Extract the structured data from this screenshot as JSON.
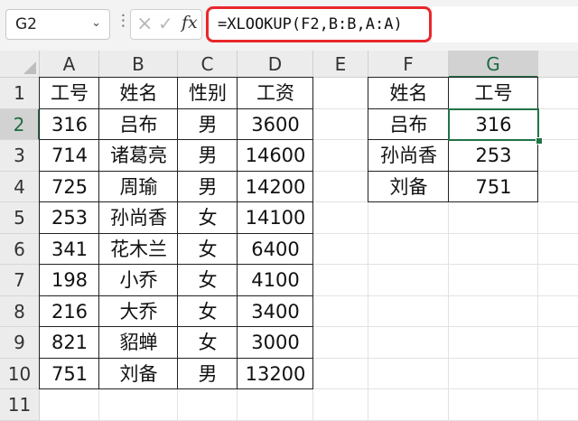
{
  "name_box": {
    "value": "G2"
  },
  "formula_bar": {
    "formula": "=XLOOKUP(F2,B:B,A:A)",
    "fx_label": "fx"
  },
  "icons": {
    "more": "vertical-dots-icon",
    "cancel": "x-icon",
    "enter": "check-icon",
    "function": "fx-icon"
  },
  "colors": {
    "highlight_border": "#e8272b",
    "selection": "#217346"
  },
  "columns": [
    "A",
    "B",
    "C",
    "D",
    "E",
    "F",
    "G"
  ],
  "rows": [
    "1",
    "2",
    "3",
    "4",
    "5",
    "6",
    "7",
    "8",
    "9",
    "10",
    "11"
  ],
  "selected": {
    "column": "G",
    "row": "2"
  },
  "table1": {
    "headers": [
      "工号",
      "姓名",
      "性别",
      "工资"
    ],
    "rows": [
      [
        "316",
        "吕布",
        "男",
        "3600"
      ],
      [
        "714",
        "诸葛亮",
        "男",
        "14600"
      ],
      [
        "725",
        "周瑜",
        "男",
        "14200"
      ],
      [
        "253",
        "孙尚香",
        "女",
        "14100"
      ],
      [
        "341",
        "花木兰",
        "女",
        "6400"
      ],
      [
        "198",
        "小乔",
        "女",
        "4100"
      ],
      [
        "216",
        "大乔",
        "女",
        "3400"
      ],
      [
        "821",
        "貂蝉",
        "女",
        "3000"
      ],
      [
        "751",
        "刘备",
        "男",
        "13200"
      ]
    ]
  },
  "table2": {
    "headers": [
      "姓名",
      "工号"
    ],
    "rows": [
      [
        "吕布",
        "316"
      ],
      [
        "孙尚香",
        "253"
      ],
      [
        "刘备",
        "751"
      ]
    ]
  }
}
